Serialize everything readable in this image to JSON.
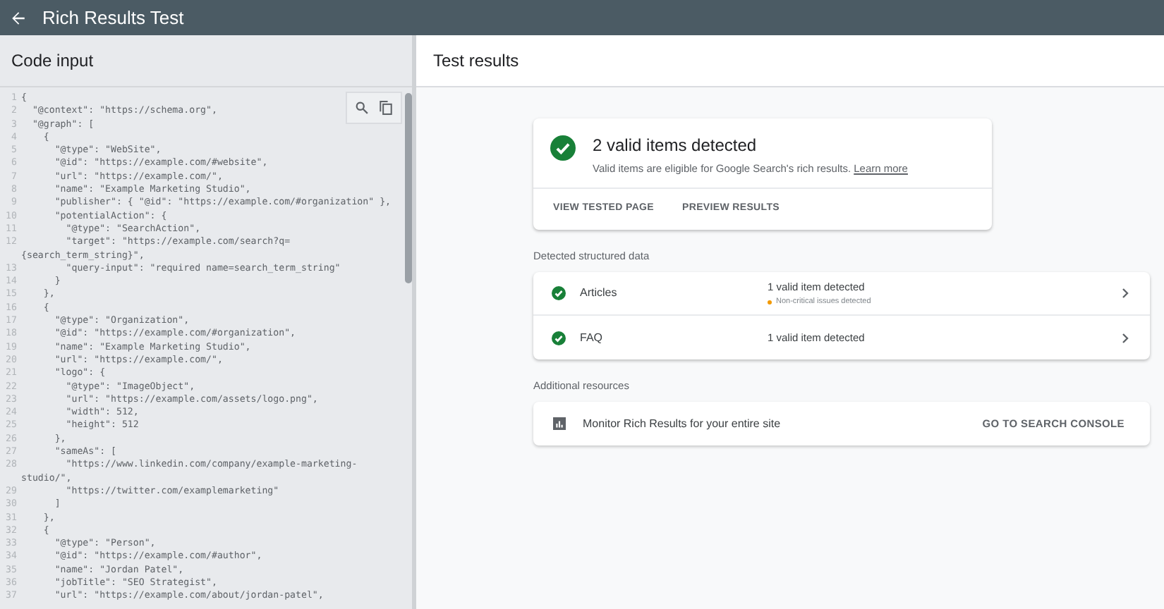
{
  "app_bar": {
    "title": "Rich Results Test"
  },
  "code_panel": {
    "title": "Code input",
    "lines": [
      {
        "number": "1",
        "text": "{"
      },
      {
        "number": "2",
        "text": "  \"@context\": \"https://schema.org\","
      },
      {
        "number": "3",
        "text": "  \"@graph\": ["
      },
      {
        "number": "4",
        "text": "    {"
      },
      {
        "number": "5",
        "text": "      \"@type\": \"WebSite\","
      },
      {
        "number": "6",
        "text": "      \"@id\": \"https://example.com/#website\","
      },
      {
        "number": "7",
        "text": "      \"url\": \"https://example.com/\","
      },
      {
        "number": "8",
        "text": "      \"name\": \"Example Marketing Studio\","
      },
      {
        "number": "9",
        "text": "      \"publisher\": { \"@id\": \"https://example.com/#organization\" },"
      },
      {
        "number": "10",
        "text": "      \"potentialAction\": {"
      },
      {
        "number": "11",
        "text": "        \"@type\": \"SearchAction\","
      },
      {
        "number": "12",
        "text": "        \"target\": \"https://example.com/search?q="
      },
      {
        "text": "{search_term_string}\","
      },
      {
        "number": "13",
        "text": "        \"query-input\": \"required name=search_term_string\""
      },
      {
        "number": "14",
        "text": "      }"
      },
      {
        "number": "15",
        "text": "    },"
      },
      {
        "number": "16",
        "text": "    {"
      },
      {
        "number": "17",
        "text": "      \"@type\": \"Organization\","
      },
      {
        "number": "18",
        "text": "      \"@id\": \"https://example.com/#organization\","
      },
      {
        "number": "19",
        "text": "      \"name\": \"Example Marketing Studio\","
      },
      {
        "number": "20",
        "text": "      \"url\": \"https://example.com/\","
      },
      {
        "number": "21",
        "text": "      \"logo\": {"
      },
      {
        "number": "22",
        "text": "        \"@type\": \"ImageObject\","
      },
      {
        "number": "23",
        "text": "        \"url\": \"https://example.com/assets/logo.png\","
      },
      {
        "number": "24",
        "text": "        \"width\": 512,"
      },
      {
        "number": "25",
        "text": "        \"height\": 512"
      },
      {
        "number": "26",
        "text": "      },"
      },
      {
        "number": "27",
        "text": "      \"sameAs\": ["
      },
      {
        "number": "28",
        "text": "        \"https://www.linkedin.com/company/example-marketing-"
      },
      {
        "text": "studio/\","
      },
      {
        "number": "29",
        "text": "        \"https://twitter.com/examplemarketing\""
      },
      {
        "number": "30",
        "text": "      ]"
      },
      {
        "number": "31",
        "text": "    },"
      },
      {
        "number": "32",
        "text": "    {"
      },
      {
        "number": "33",
        "text": "      \"@type\": \"Person\","
      },
      {
        "number": "34",
        "text": "      \"@id\": \"https://example.com/#author\","
      },
      {
        "number": "35",
        "text": "      \"name\": \"Jordan Patel\","
      },
      {
        "number": "36",
        "text": "      \"jobTitle\": \"SEO Strategist\","
      },
      {
        "number": "37",
        "text": "      \"url\": \"https://example.com/about/jordan-patel\","
      }
    ]
  },
  "results": {
    "title": "Test results",
    "summary": {
      "title": "2 valid items detected",
      "description": "Valid items are eligible for Google Search's rich results.",
      "link": "Learn more",
      "actions": [
        "VIEW TESTED PAGE",
        "PREVIEW RESULTS"
      ]
    },
    "detected_heading": "Detected structured data",
    "detected": [
      {
        "name": "Articles",
        "status": "1 valid item detected",
        "note": "Non-critical issues detected",
        "color": "#f29900"
      },
      {
        "name": "FAQ",
        "status": "1 valid item detected"
      }
    ],
    "resources_heading": "Additional resources",
    "resource": {
      "label": "Monitor Rich Results for your entire site",
      "action": "GO TO SEARCH CONSOLE"
    }
  }
}
